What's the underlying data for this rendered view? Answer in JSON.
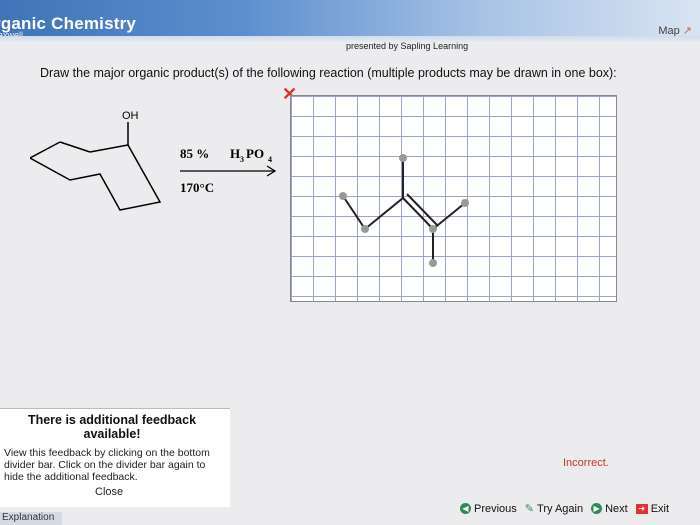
{
  "header": {
    "title": "rganic Chemistry",
    "subtitle": "laxwell",
    "presented_by": "presented by Sapling Learning",
    "map_label": "Map"
  },
  "question": {
    "text": "Draw the major organic product(s) of the following reaction (multiple products may be drawn in one box):"
  },
  "reaction": {
    "oh_label": "OH",
    "reagent": "85% H3PO4",
    "reagent_percent": "85 %",
    "reagent_formula": "H",
    "reagent_sub1": "3",
    "reagent_po": "PO",
    "reagent_sub2": "4",
    "temperature": "170°C"
  },
  "answer": {
    "status": "Incorrect."
  },
  "feedback": {
    "title": "There is additional feedback available!",
    "body": "View this feedback by clicking on the bottom divider bar. Click on the divider bar again to hide the additional feedback.",
    "close_label": "Close"
  },
  "nav": {
    "previous": "Previous",
    "try_again": "Try Again",
    "next": "Next",
    "exit": "Exit"
  },
  "footer": {
    "explanation": "Explanation"
  },
  "colors": {
    "incorrect": "#c0392b",
    "header_blue": "#3f74b8"
  }
}
